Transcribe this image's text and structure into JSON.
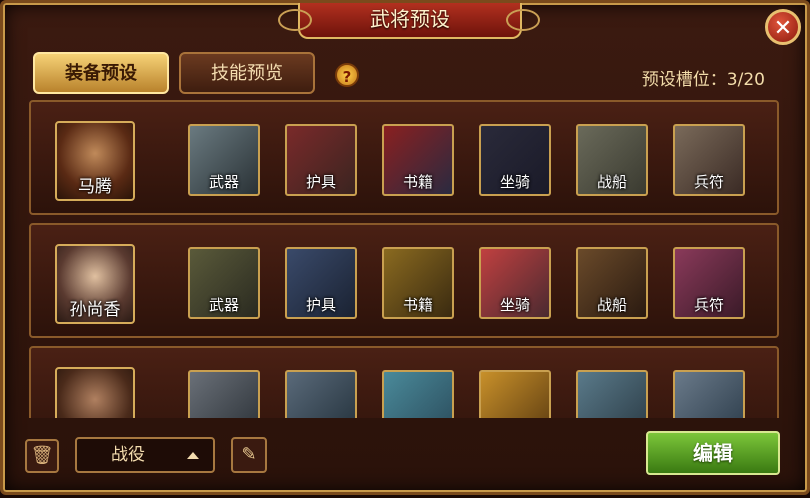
{
  "window": {
    "title": "武将预设",
    "close_icon": "close-icon"
  },
  "tabs": [
    {
      "label": "装备预设",
      "active": true
    },
    {
      "label": "技能预览",
      "active": false
    }
  ],
  "help_glyph": "?",
  "slots_info": "预设槽位：3/20",
  "colors": {
    "accent_gold": "#f6d276",
    "title_red": "#b2301f",
    "edit_green": "#7cc63a"
  },
  "rows": [
    {
      "hero_name": "马腾",
      "items": [
        {
          "label": "武器",
          "icon": "sword-icon"
        },
        {
          "label": "护具",
          "icon": "armor-icon"
        },
        {
          "label": "书籍",
          "icon": "book-icon"
        },
        {
          "label": "坐骑",
          "icon": "horse-icon"
        },
        {
          "label": "战船",
          "icon": "warship-icon"
        },
        {
          "label": "兵符",
          "icon": "tiger-tally-icon"
        }
      ]
    },
    {
      "hero_name": "孙尚香",
      "items": [
        {
          "label": "武器",
          "icon": "bow-icon"
        },
        {
          "label": "护具",
          "icon": "armor-icon"
        },
        {
          "label": "书籍",
          "icon": "book-icon"
        },
        {
          "label": "坐骑",
          "icon": "tiger-mount-icon"
        },
        {
          "label": "战船",
          "icon": "warship-icon"
        },
        {
          "label": "兵符",
          "icon": "phoenix-tally-icon"
        }
      ]
    },
    {
      "hero_name": "",
      "items": [
        {
          "label": "",
          "icon": "hammer-icon"
        },
        {
          "label": "",
          "icon": "armor-icon"
        },
        {
          "label": "",
          "icon": "scroll-icon"
        },
        {
          "label": "",
          "icon": "golden-ox-icon"
        },
        {
          "label": "",
          "icon": "warship-icon"
        },
        {
          "label": "",
          "icon": "beast-tally-icon"
        }
      ]
    }
  ],
  "bottom": {
    "trash_icon": "trash-icon",
    "dropdown_value": "战役",
    "brush_icon": "brush-icon",
    "edit_label": "编辑"
  }
}
